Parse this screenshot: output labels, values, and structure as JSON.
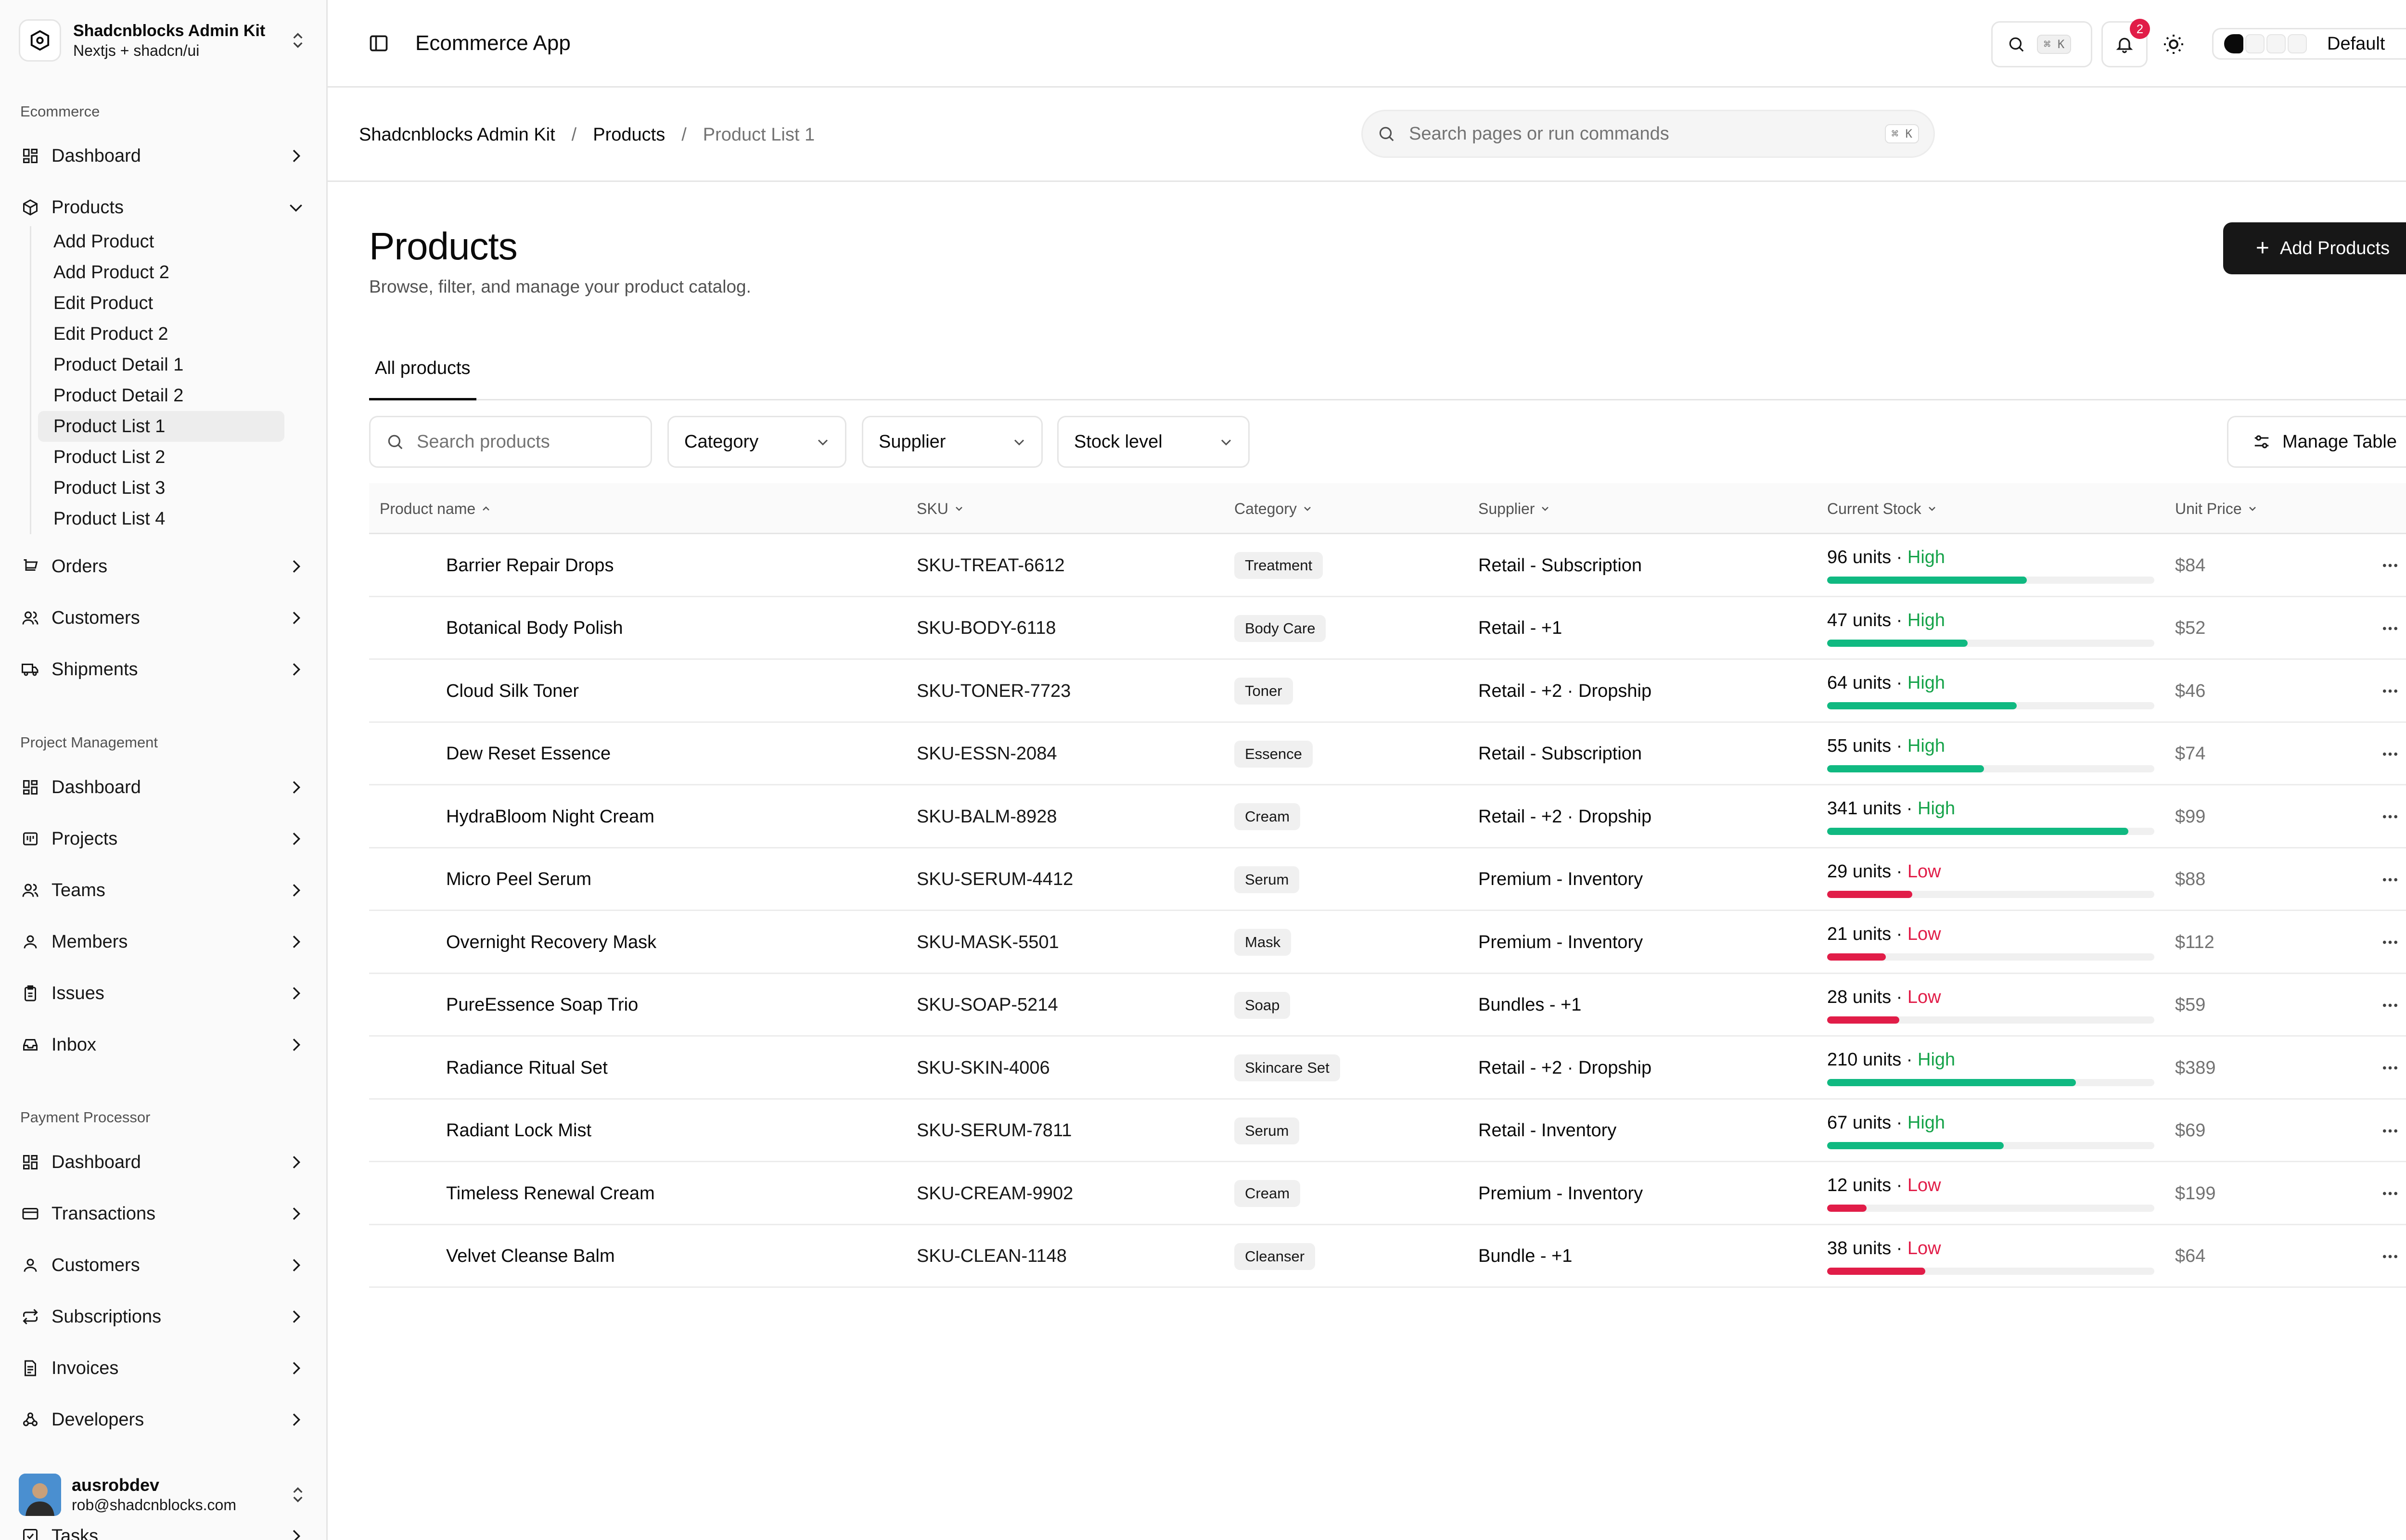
{
  "brand": {
    "name": "Shadcnblocks Admin Kit",
    "subtitle": "Nextjs + shadcn/ui"
  },
  "sidebar": {
    "groups": [
      {
        "label": "Ecommerce"
      },
      {
        "label": "Project Management"
      },
      {
        "label": "Payment Processor"
      }
    ],
    "ecommerce": {
      "dashboard": "Dashboard",
      "products": "Products",
      "orders": "Orders",
      "customers": "Customers",
      "shipments": "Shipments"
    },
    "product_sub_items": [
      {
        "label": "Add Product"
      },
      {
        "label": "Add Product 2"
      },
      {
        "label": "Edit Product"
      },
      {
        "label": "Edit Product 2"
      },
      {
        "label": "Product Detail 1"
      },
      {
        "label": "Product Detail 2"
      },
      {
        "label": "Product List 1",
        "active": true
      },
      {
        "label": "Product List 2"
      },
      {
        "label": "Product List 3"
      },
      {
        "label": "Product List 4"
      }
    ],
    "project": {
      "dashboard": "Dashboard",
      "projects": "Projects",
      "teams": "Teams",
      "members": "Members",
      "issues": "Issues",
      "inbox": "Inbox"
    },
    "payment": {
      "dashboard": "Dashboard",
      "transactions": "Transactions",
      "customers": "Customers",
      "subscriptions": "Subscriptions",
      "invoices": "Invoices",
      "developers": "Developers"
    },
    "tasks_peek": "Tasks",
    "user": {
      "name": "ausrobdev",
      "email": "rob@shadcnblocks.com"
    }
  },
  "header": {
    "app_title": "Ecommerce App",
    "search_kbd": "⌘ K",
    "notification_count": "2",
    "theme_label": "Default"
  },
  "breadcrumb": {
    "items": [
      "Shadcnblocks Admin Kit",
      "Products",
      "Product List 1"
    ],
    "separator": "/"
  },
  "command_search": {
    "placeholder": "Search pages or run commands",
    "kbd": "⌘ K"
  },
  "page": {
    "title": "Products",
    "subtitle": "Browse, filter, and manage your product catalog.",
    "add_button": "Add Products",
    "tab": "All products"
  },
  "filters": {
    "search_placeholder": "Search products",
    "category": "Category",
    "supplier": "Supplier",
    "stock_level": "Stock level",
    "manage_table": "Manage Table"
  },
  "table": {
    "columns": [
      "Product name",
      "SKU",
      "Category",
      "Supplier",
      "Current Stock",
      "Unit Price"
    ],
    "rows": [
      {
        "name": "Barrier Repair Drops",
        "sku": "SKU-TREAT-6612",
        "category": "Treatment",
        "supplier": "Retail - Subscription",
        "stock": "96 units",
        "level": "High",
        "fill": 0.61,
        "price": "$84"
      },
      {
        "name": "Botanical Body Polish",
        "sku": "SKU-BODY-6118",
        "category": "Body Care",
        "supplier": "Retail - +1",
        "stock": "47 units",
        "level": "High",
        "fill": 0.43,
        "price": "$52"
      },
      {
        "name": "Cloud Silk Toner",
        "sku": "SKU-TONER-7723",
        "category": "Toner",
        "supplier": "Retail - +2 · Dropship",
        "stock": "64 units",
        "level": "High",
        "fill": 0.58,
        "price": "$46"
      },
      {
        "name": "Dew Reset Essence",
        "sku": "SKU-ESSN-2084",
        "category": "Essence",
        "supplier": "Retail - Subscription",
        "stock": "55 units",
        "level": "High",
        "fill": 0.48,
        "price": "$74"
      },
      {
        "name": "HydraBloom Night Cream",
        "sku": "SKU-BALM-8928",
        "category": "Cream",
        "supplier": "Retail - +2 · Dropship",
        "stock": "341 units",
        "level": "High",
        "fill": 0.92,
        "price": "$99"
      },
      {
        "name": "Micro Peel Serum",
        "sku": "SKU-SERUM-4412",
        "category": "Serum",
        "supplier": "Premium - Inventory",
        "stock": "29 units",
        "level": "Low",
        "fill": 0.26,
        "price": "$88"
      },
      {
        "name": "Overnight Recovery Mask",
        "sku": "SKU-MASK-5501",
        "category": "Mask",
        "supplier": "Premium - Inventory",
        "stock": "21 units",
        "level": "Low",
        "fill": 0.18,
        "price": "$112"
      },
      {
        "name": "PureEssence Soap Trio",
        "sku": "SKU-SOAP-5214",
        "category": "Soap",
        "supplier": "Bundles - +1",
        "stock": "28 units",
        "level": "Low",
        "fill": 0.22,
        "price": "$59"
      },
      {
        "name": "Radiance Ritual Set",
        "sku": "SKU-SKIN-4006",
        "category": "Skincare Set",
        "supplier": "Retail - +2 · Dropship",
        "stock": "210 units",
        "level": "High",
        "fill": 0.76,
        "price": "$389"
      },
      {
        "name": "Radiant Lock Mist",
        "sku": "SKU-SERUM-7811",
        "category": "Serum",
        "supplier": "Retail - Inventory",
        "stock": "67 units",
        "level": "High",
        "fill": 0.54,
        "price": "$69"
      },
      {
        "name": "Timeless Renewal Cream",
        "sku": "SKU-CREAM-9902",
        "category": "Cream",
        "supplier": "Premium - Inventory",
        "stock": "12 units",
        "level": "Low",
        "fill": 0.12,
        "price": "$199"
      },
      {
        "name": "Velvet Cleanse Balm",
        "sku": "SKU-CLEAN-1148",
        "category": "Cleanser",
        "supplier": "Bundle - +1",
        "stock": "38 units",
        "level": "Low",
        "fill": 0.3,
        "price": "$64"
      }
    ]
  },
  "colors": {
    "high": "#16a34a",
    "high_bar": "#10b981",
    "low": "#e11d48",
    "low_bar": "#e11d48",
    "badge": "#e11d48"
  }
}
